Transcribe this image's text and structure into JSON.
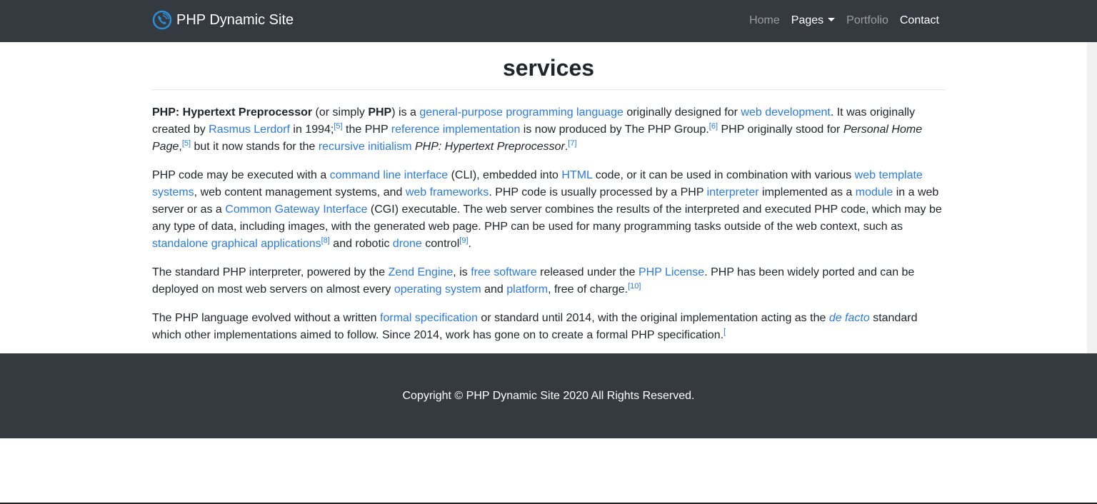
{
  "nav": {
    "brand": "PHP Dynamic Site",
    "items": [
      {
        "label": "Home",
        "active": false
      },
      {
        "label": "Pages",
        "active": true,
        "dropdown": true
      },
      {
        "label": "Portfolio",
        "active": false
      },
      {
        "label": "Contact",
        "active": true
      }
    ]
  },
  "page": {
    "title": "services"
  },
  "paragraphs": [
    [
      [
        "b",
        "PHP: Hypertext Preprocessor"
      ],
      [
        "t",
        " (or simply "
      ],
      [
        "b",
        "PHP"
      ],
      [
        "t",
        ") is a "
      ],
      [
        "a",
        "general-purpose programming language"
      ],
      [
        "t",
        " originally designed for "
      ],
      [
        "a",
        "web development"
      ],
      [
        "t",
        ". It was originally created by "
      ],
      [
        "a",
        "Rasmus Lerdorf"
      ],
      [
        "t",
        " in 1994;"
      ],
      [
        "s",
        "[5]"
      ],
      [
        "t",
        " the PHP "
      ],
      [
        "a",
        "reference implementation"
      ],
      [
        "t",
        " is now produced by The PHP Group."
      ],
      [
        "s",
        "[6]"
      ],
      [
        "t",
        " PHP originally stood for "
      ],
      [
        "i",
        "Personal Home Page"
      ],
      [
        "t",
        ","
      ],
      [
        "s",
        "[5]"
      ],
      [
        "t",
        " but it now stands for the "
      ],
      [
        "a",
        "recursive initialism"
      ],
      [
        "t",
        " "
      ],
      [
        "i",
        "PHP: Hypertext Preprocessor"
      ],
      [
        "t",
        "."
      ],
      [
        "s",
        "[7]"
      ]
    ],
    [
      [
        "t",
        "PHP code may be executed with a "
      ],
      [
        "a",
        "command line interface"
      ],
      [
        "t",
        " (CLI), embedded into "
      ],
      [
        "a",
        "HTML"
      ],
      [
        "t",
        " code, or it can be used in combination with various "
      ],
      [
        "a",
        "web template systems"
      ],
      [
        "t",
        ", web content management systems, and "
      ],
      [
        "a",
        "web frameworks"
      ],
      [
        "t",
        ". PHP code is usually processed by a PHP "
      ],
      [
        "a",
        "interpreter"
      ],
      [
        "t",
        " implemented as a "
      ],
      [
        "a",
        "module"
      ],
      [
        "t",
        " in a web server or as a "
      ],
      [
        "a",
        "Common Gateway Interface"
      ],
      [
        "t",
        " (CGI) executable. The web server combines the results of the interpreted and executed PHP code, which may be any type of data, including images, with the generated web page. PHP can be used for many programming tasks outside of the web context, such as "
      ],
      [
        "a",
        "standalone graphical applications"
      ],
      [
        "s",
        "[8]"
      ],
      [
        "t",
        " and robotic "
      ],
      [
        "a",
        "drone"
      ],
      [
        "t",
        " control"
      ],
      [
        "s",
        "[9]"
      ],
      [
        "t",
        "."
      ]
    ],
    [
      [
        "t",
        "The standard PHP interpreter, powered by the "
      ],
      [
        "a",
        "Zend Engine"
      ],
      [
        "t",
        ", is "
      ],
      [
        "a",
        "free software"
      ],
      [
        "t",
        " released under the "
      ],
      [
        "a",
        "PHP License"
      ],
      [
        "t",
        ". PHP has been widely ported and can be deployed on most web servers on almost every "
      ],
      [
        "a",
        "operating system"
      ],
      [
        "t",
        " and "
      ],
      [
        "a",
        "platform"
      ],
      [
        "t",
        ", free of charge."
      ],
      [
        "s",
        "[10]"
      ]
    ],
    [
      [
        "t",
        "The PHP language evolved without a written "
      ],
      [
        "a",
        "formal specification"
      ],
      [
        "t",
        " or standard until 2014, with the original implementation acting as the "
      ],
      [
        "ai",
        "de facto"
      ],
      [
        "t",
        " standard which other implementations aimed to follow. Since 2014, work has gone on to create a formal PHP specification."
      ],
      [
        "s",
        "["
      ]
    ]
  ],
  "footer": {
    "copyright": "Copyright © PHP Dynamic Site 2020 All Rights Reserved."
  }
}
